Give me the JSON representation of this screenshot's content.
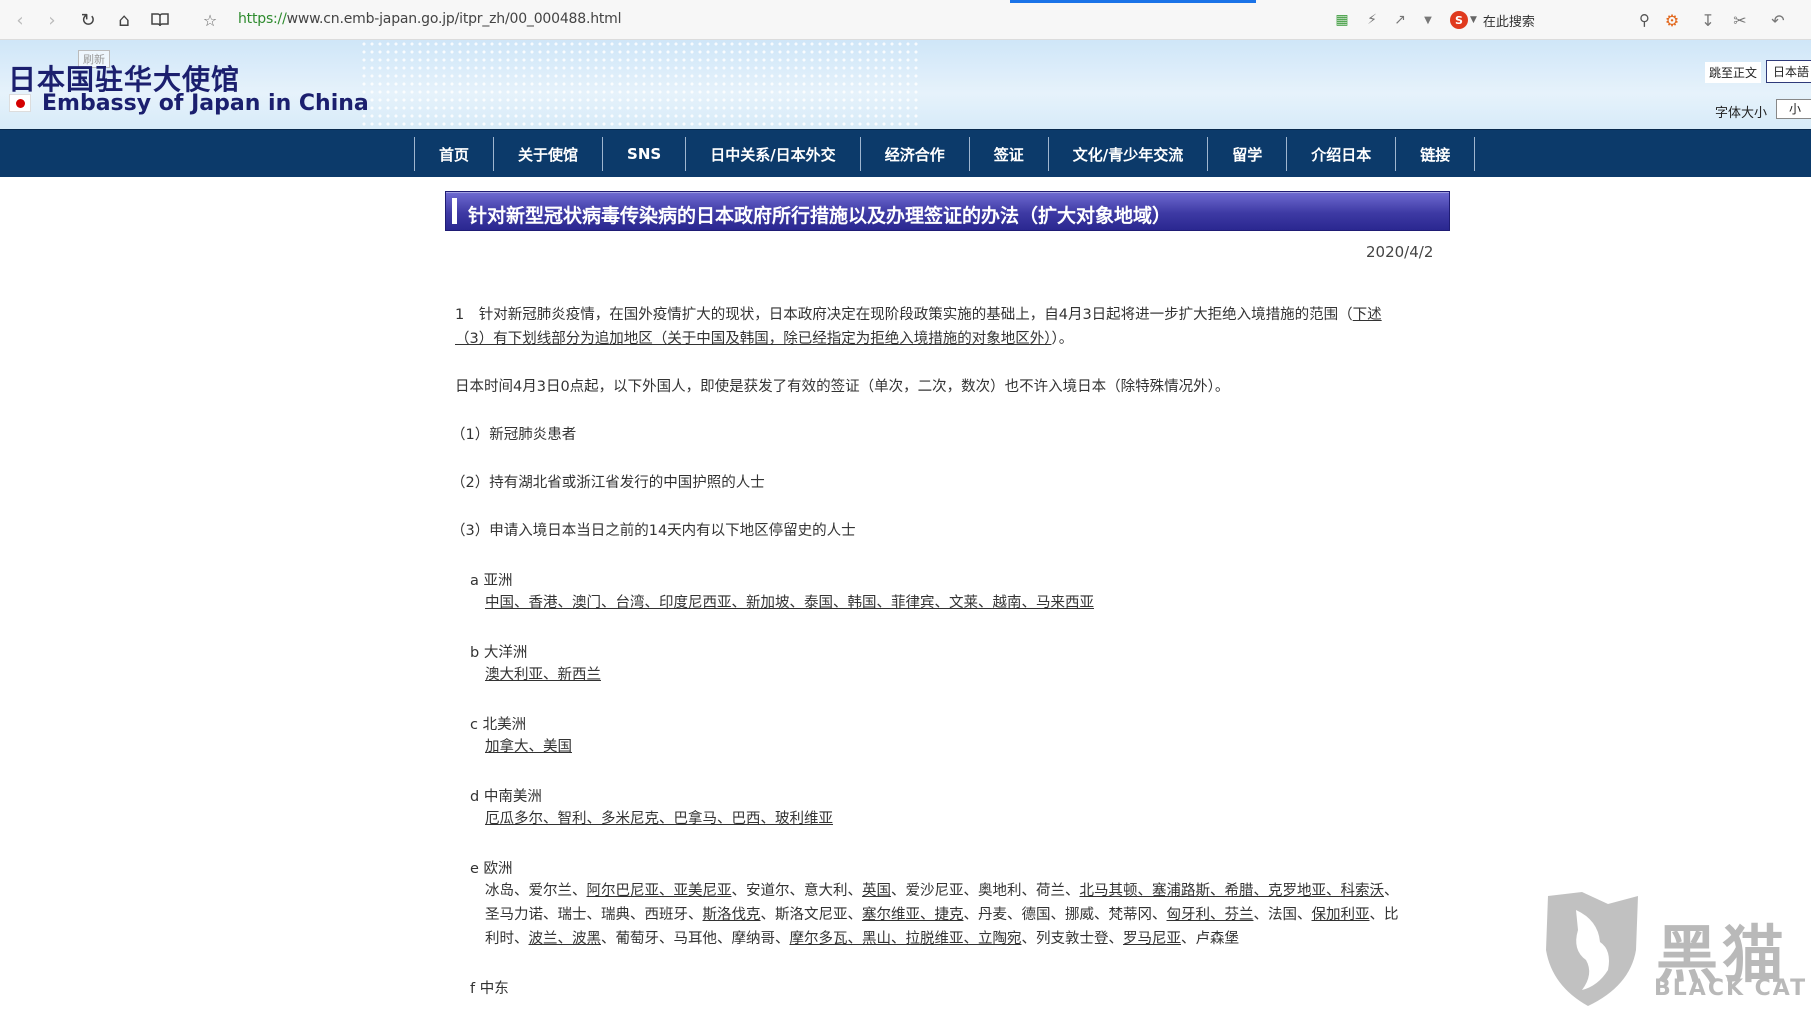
{
  "browser": {
    "url_scheme": "https://",
    "url_rest": "www.cn.emb-japan.go.jp/itpr_zh/00_000488.html",
    "search_placeholder": "在此搜索",
    "search_logo": "S",
    "icons": [
      "back-icon",
      "forward-icon",
      "reload-icon",
      "home-icon",
      "reader-icon",
      "star-icon",
      "book-icon",
      "lightning-icon",
      "share-icon",
      "chevron-down-icon",
      "search-icon",
      "gamepad-icon",
      "download-icon",
      "scissors-icon",
      "undo-icon"
    ]
  },
  "header": {
    "refresh_badge": "刷新",
    "title_cn": "日本国驻华大使馆",
    "title_en": "Embassy of Japan in China",
    "skip_link": "跳至正文",
    "lang_button": "日本語",
    "font_size_label": "字体大小",
    "font_size_value": "小"
  },
  "nav": {
    "items": [
      "首页",
      "关于使馆",
      "SNS",
      "日中关系/日本外交",
      "经济合作",
      "签证",
      "文化/青少年交流",
      "留学",
      "介绍日本",
      "链接"
    ]
  },
  "article": {
    "title": "针对新型冠状病毒传染病的日本政府所行措施以及办理签证的办法（扩大对象地域）",
    "date": "2020/4/2",
    "para1_prefix": "1　针对新冠肺炎疫情，在国外疫情扩大的现状，日本政府决定在现阶段政策实施的基础上，自4月3日起将进一步扩大拒绝入境措施的范围（",
    "para1_link1": "下述",
    "para1_line2_link": "（3）有下划线部分为追加地区（关于中国及韩国，除已经指定为拒绝入境措施的对象地区外）",
    "para1_suffix": "）。",
    "para2": "日本时间4月3日0点起，以下外国人，即使是获发了有效的签证（单次，二次，数次）也不许入境日本（除特殊情况外）。",
    "item1": "（1）新冠肺炎患者",
    "item2": "（2）持有湖北省或浙江省发行的中国护照的人士",
    "item3": "（3）申请入境日本当日之前的14天内有以下地区停留史的人士",
    "regions": {
      "a_label": "a 亚洲",
      "a_list": "中国、香港、澳门、台湾、印度尼西亚、新加坡、泰国、韩国、菲律宾、文莱、越南、马来西亚",
      "b_label": "b 大洋洲",
      "b_list": "澳大利亚、新西兰",
      "c_label": "c 北美洲",
      "c_list": "加拿大、美国",
      "d_label": "d 中南美洲",
      "d_list": "厄瓜多尔、智利、多米尼克、巴拿马、巴西、玻利维亚",
      "e_label": "e 欧洲",
      "e_line1_a": "冰岛、爱尔兰、",
      "e_line1_b": "阿尔巴尼亚、亚美尼亚",
      "e_line1_c": "、安道尔、意大利、",
      "e_line1_d": "英国",
      "e_line1_e": "、爱沙尼亚、奥地利、荷兰、",
      "e_line1_f": "北马其顿、塞浦路斯、希腊、克罗地亚、科索沃",
      "e_line1_g": "、",
      "e_line2_a": "圣马力诺、瑞士、瑞典、西班牙、",
      "e_line2_b": "斯洛伐克",
      "e_line2_c": "、斯洛文尼亚、",
      "e_line2_d": "塞尔维亚、捷克",
      "e_line2_e": "、丹麦、德国、挪威、梵蒂冈、",
      "e_line2_f": "匈牙利、芬兰",
      "e_line2_g": "、法国、",
      "e_line2_h": "保加利亚",
      "e_line2_i": "、比",
      "e_line3_a": "利时、",
      "e_line3_b": "波兰、波黑",
      "e_line3_c": "、葡萄牙、马耳他、摩纳哥、",
      "e_line3_d": "摩尔多瓦、黑山、拉脱维亚、立陶宛",
      "e_line3_e": "、列支敦士登、",
      "e_line3_f": "罗马尼亚",
      "e_line3_g": "、卢森堡",
      "f_label": "f 中东"
    }
  },
  "watermark": {
    "cn": "黑猫",
    "en": "BLACK CAT"
  }
}
